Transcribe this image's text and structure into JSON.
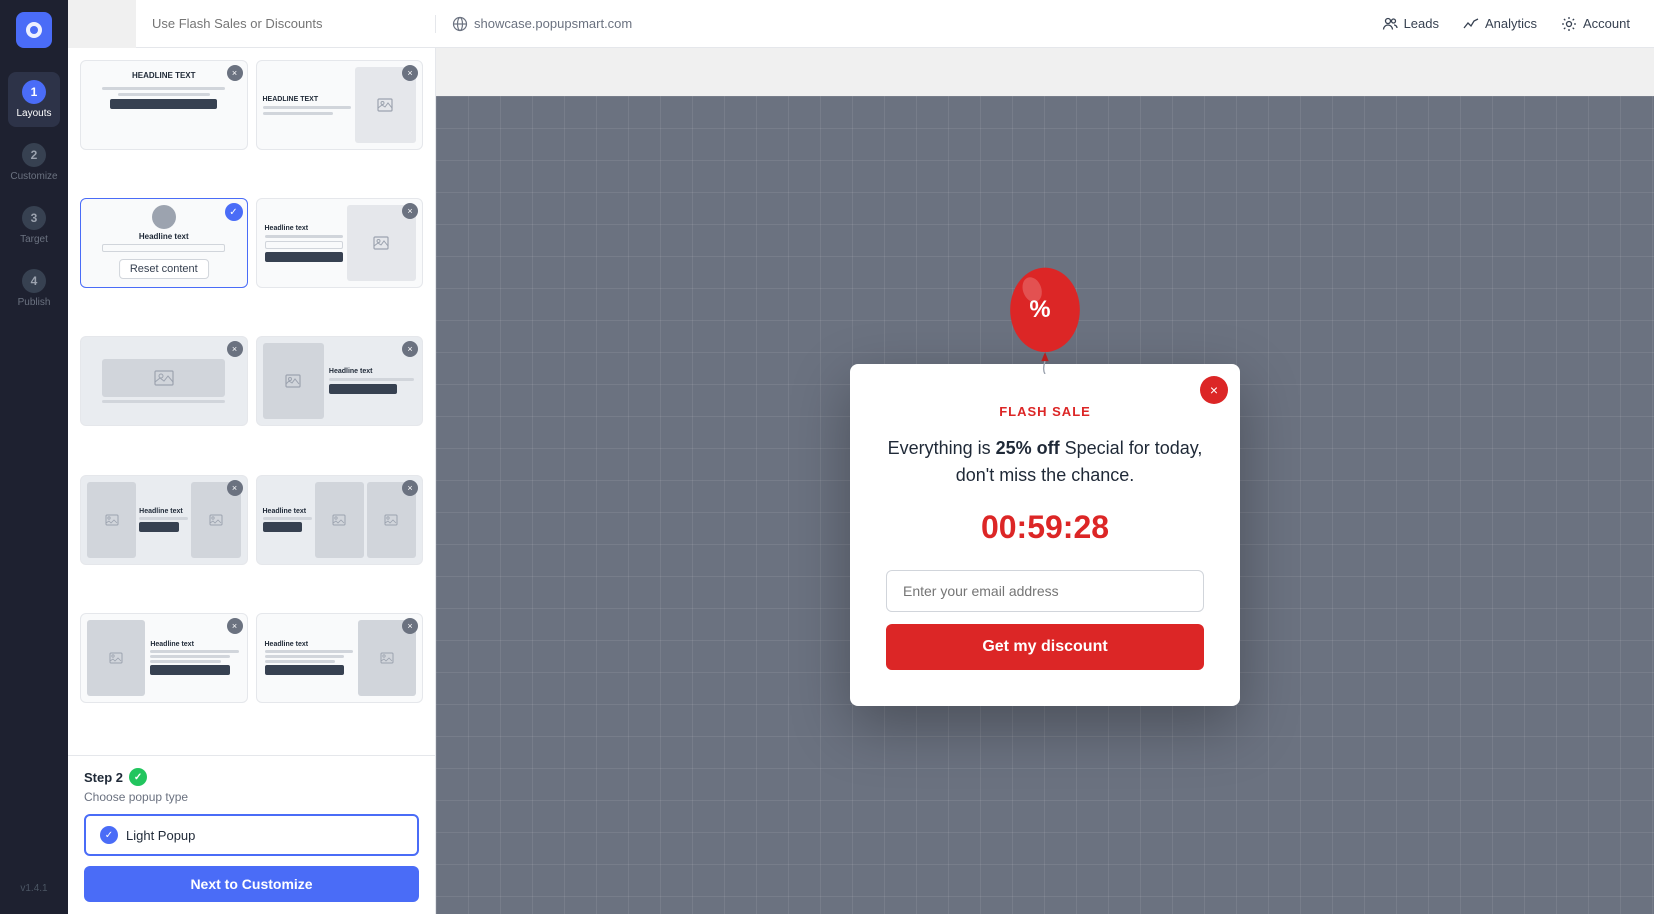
{
  "header": {
    "search_placeholder": "Use Flash Sales or Discounts",
    "url": "showcase.popupsmart.com",
    "nav_items": [
      {
        "id": "leads",
        "label": "Leads"
      },
      {
        "id": "analytics",
        "label": "Analytics"
      },
      {
        "id": "account",
        "label": "Account"
      }
    ]
  },
  "sidebar": {
    "steps": [
      {
        "number": "1",
        "label": "Layouts",
        "active": true
      },
      {
        "number": "2",
        "label": "Customize",
        "active": false
      },
      {
        "number": "3",
        "label": "Target",
        "active": false
      },
      {
        "number": "4",
        "label": "Publish",
        "active": false
      }
    ],
    "version": "v1.4.1"
  },
  "layouts": {
    "cards": [
      {
        "id": "card1",
        "type": "headline-top",
        "selected": false
      },
      {
        "id": "card2",
        "type": "headline-side",
        "selected": false
      },
      {
        "id": "card3",
        "type": "avatar-center",
        "selected": true
      },
      {
        "id": "card4",
        "type": "split-layout",
        "selected": false
      },
      {
        "id": "card5",
        "type": "image-left",
        "selected": false
      },
      {
        "id": "card6",
        "type": "image-side",
        "selected": false
      },
      {
        "id": "card7",
        "type": "three-col",
        "selected": false
      },
      {
        "id": "card8",
        "type": "three-col-2",
        "selected": false
      },
      {
        "id": "card9",
        "type": "text-image-left",
        "selected": false
      },
      {
        "id": "card10",
        "type": "text-image-right",
        "selected": false
      }
    ],
    "reset_btn_label": "Reset content",
    "headline_text": "Headline text"
  },
  "step2": {
    "label": "Step 2",
    "sublabel": "Choose popup type",
    "popup_type": "Light Popup",
    "next_btn_label": "Next to Customize"
  },
  "popup": {
    "close_icon": "×",
    "tag": "FLASH SALE",
    "headline_part1": "Everything is ",
    "headline_bold": "25% off",
    "headline_part2": " Special for today, don't miss the chance.",
    "timer": "00:59:28",
    "email_placeholder": "Enter your email address",
    "cta_label": "Get my discount"
  }
}
